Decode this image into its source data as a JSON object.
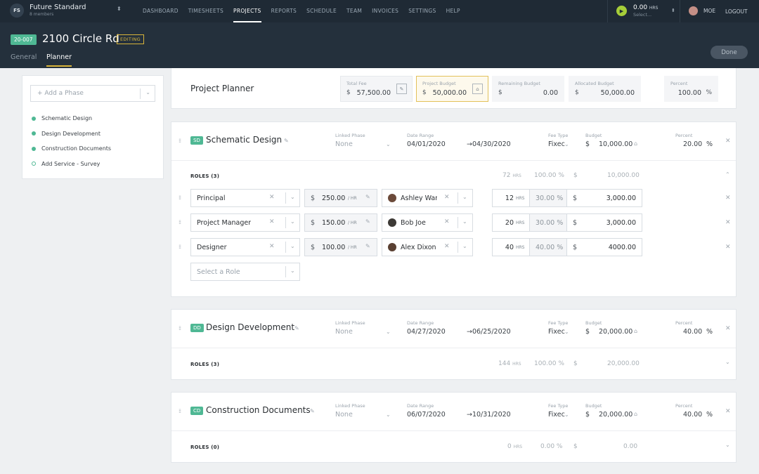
{
  "topbar": {
    "org_initials": "FS",
    "org_name": "Future Standard",
    "org_members": "8 members",
    "nav": [
      "DASHBOARD",
      "TIMESHEETS",
      "PROJECTS",
      "REPORTS",
      "SCHEDULE",
      "TEAM",
      "INVOICES",
      "SETTINGS",
      "HELP"
    ],
    "active_nav": "PROJECTS",
    "timer_hours": "0.00",
    "timer_unit": "HRS",
    "timer_select": "Select...",
    "user_name": "MOE",
    "logout": "LOGOUT"
  },
  "project": {
    "code": "20-007",
    "title": "2100 Circle Rd",
    "status": "EDITING",
    "tab_general": "General",
    "tab_planner": "Planner",
    "done": "Done"
  },
  "sidebar": {
    "add_phase": "+ Add a Phase",
    "phases": [
      "Schematic Design",
      "Design Development",
      "Construction Documents",
      "Add Service - Survey"
    ]
  },
  "planner": {
    "title": "Project Planner",
    "total_fee_label": "Total Fee",
    "total_fee": "57,500.00",
    "budget_label": "Project Budget",
    "budget": "50,000.00",
    "remaining_label": "Remaining Budget",
    "remaining": "0.00",
    "allocated_label": "Allocated Budget",
    "allocated": "50,000.00",
    "percent_label": "Percent",
    "percent": "100.00",
    "dollar": "$",
    "pct_sign": "%"
  },
  "labels": {
    "linked_phase": "Linked Phase",
    "date_range": "Date Range",
    "fee_type": "Fee Type",
    "budget": "Budget",
    "percent": "Percent",
    "none": "None",
    "fee_fixed": "Fixec",
    "hrs": "HRS",
    "per_hr": "/ HR",
    "select_role": "Select a Role"
  },
  "phases": [
    {
      "abbr": "SD",
      "name": "Schematic Design",
      "start": "04/01/2020",
      "end": "→04/30/2020",
      "budget": "10,000.00",
      "percent": "20.00",
      "roles_label": "ROLES (3)",
      "sum_hrs": "72",
      "sum_pct": "100.00 %",
      "sum_amt": "10,000.00",
      "roles": [
        {
          "role": "Principal",
          "rate": "250.00",
          "person": "Ashley War",
          "hrs": "12",
          "pct": "30.00 %",
          "amt": "3,000.00"
        },
        {
          "role": "Project Manager",
          "rate": "150.00",
          "person": "Bob Joe",
          "hrs": "20",
          "pct": "30.00 %",
          "amt": "3,000.00"
        },
        {
          "role": "Designer",
          "rate": "100.00",
          "person": "Alex Dixon",
          "hrs": "40",
          "pct": "40.00 %",
          "amt": "4000.00"
        }
      ]
    },
    {
      "abbr": "DD",
      "name": "Design Development",
      "start": "04/27/2020",
      "end": "→06/25/2020",
      "budget": "20,000.00",
      "percent": "40.00",
      "roles_label": "ROLES (3)",
      "sum_hrs": "144",
      "sum_pct": "100.00 %",
      "sum_amt": "20,000.00"
    },
    {
      "abbr": "CD",
      "name": "Construction Documents",
      "start": "06/07/2020",
      "end": "→10/31/2020",
      "budget": "20,000.00",
      "percent": "40.00",
      "roles_label": "ROLES (0)",
      "sum_hrs": "0",
      "sum_pct": "0.00 %",
      "sum_amt": "0.00"
    }
  ]
}
